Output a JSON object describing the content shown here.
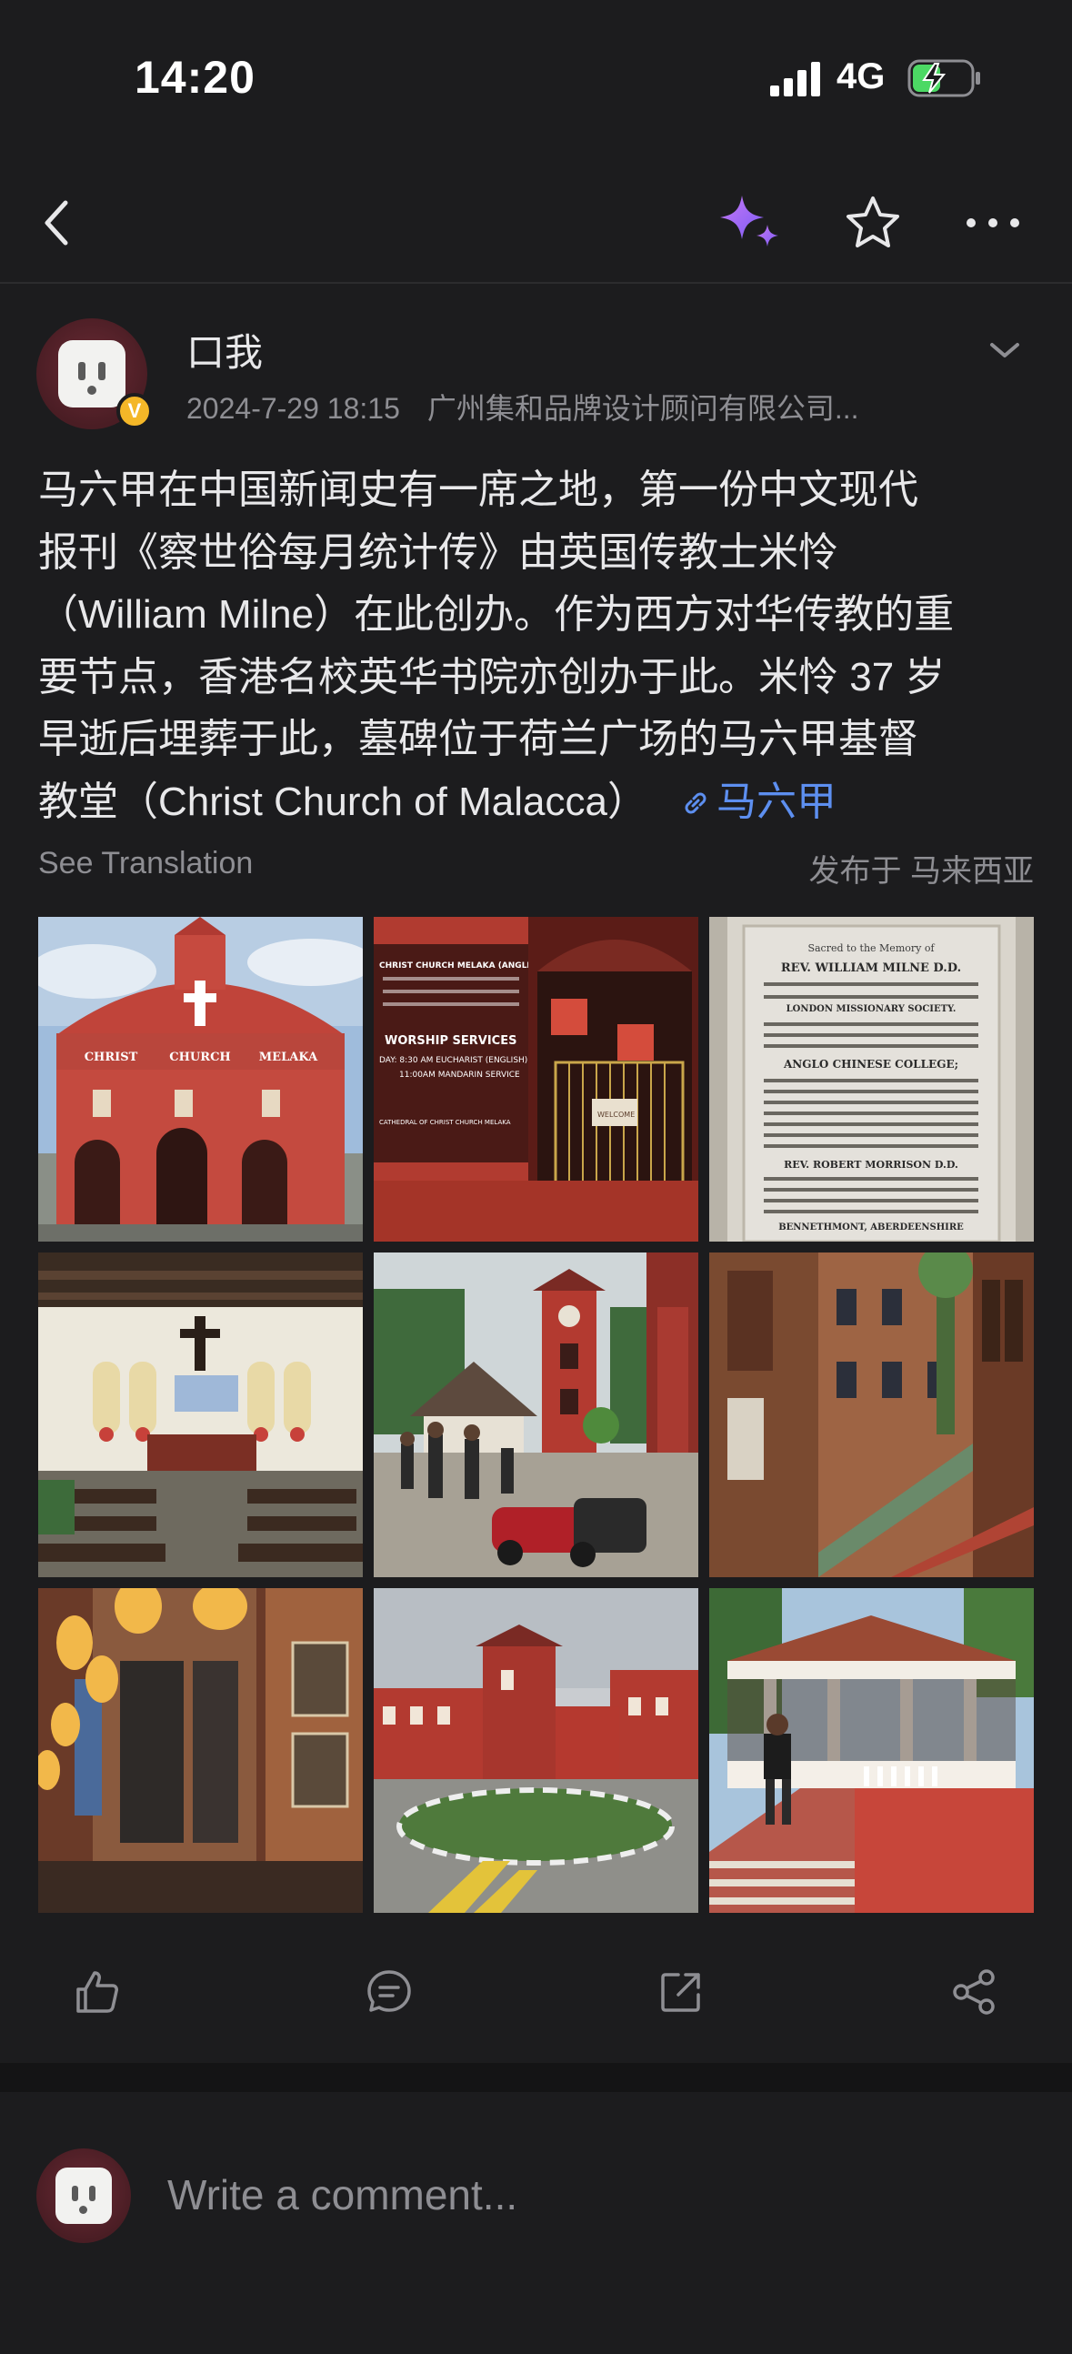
{
  "status_bar": {
    "time": "14:20",
    "network": "4G",
    "icons": [
      "signal-icon",
      "battery-charging-icon"
    ]
  },
  "nav": {
    "icons": [
      "back-icon",
      "ai-sparkle-icon",
      "star-icon",
      "more-icon"
    ],
    "accent_color": "#a46cf0"
  },
  "post": {
    "author": "口我",
    "verified_badge": "V",
    "date": "2024-7-29 18:15",
    "company": "广州集和品牌设计顾问有限公司...",
    "text_lines": [
      "马六甲在中国新闻史有一席之地，第一份中文现代",
      "报刊《察世俗每月统计传》由英国传教士米怜",
      "（William Milne）在此创办。作为西方对华传教的重",
      "要节点，香港名校英华书院亦创办于此。米怜 37 岁",
      "早逝后埋葬于此，墓碑位于荷兰广场的马六甲基督",
      "教堂（Christ Church of Malacca）"
    ],
    "topic_link": "马六甲",
    "link_color": "#5d8ff0",
    "see_translation": "See Translation",
    "posted_in": "发布于 马来西亚"
  },
  "photos": {
    "church_sign": {
      "left": "CHRIST",
      "middle": "CHURCH",
      "right": "MELAKA"
    },
    "door_sign": {
      "line1": "CHRIST CHURCH MELAKA (ANGLICAN CHURCH)",
      "heading": "WORSHIP SERVICES",
      "line2": "DAY: 8:30 AM   EUCHARIST (ENGLISH)",
      "line3": "11:00AM   MANDARIN SERVICE",
      "footer": "CATHEDRAL OF CHRIST CHURCH MELAKA"
    },
    "gate_sign": "WELCOME",
    "tablet": {
      "line1": "Sacred to the Memory of",
      "line2": "REV. WILLIAM MILNE D.D.",
      "line3": "LONDON MISSIONARY SOCIETY.",
      "line4": "ANGLO CHINESE COLLEGE;",
      "line5": "REV. ROBERT MORRISON D.D.",
      "line6": "BENNETHMONT, ABERDEENSHIRE"
    }
  },
  "comment": {
    "placeholder": "Write a comment..."
  },
  "actions": {
    "icons": [
      "like-icon",
      "comment-icon",
      "share-out-icon",
      "share-icon"
    ]
  }
}
